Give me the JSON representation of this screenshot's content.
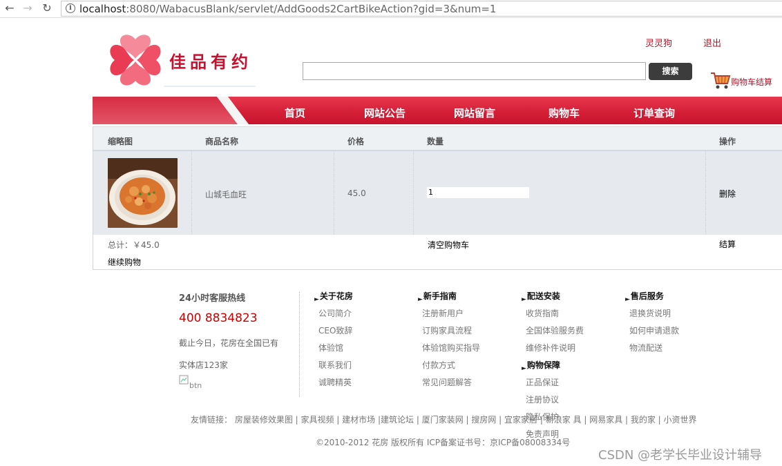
{
  "browser": {
    "url_host": "localhost",
    "url_rest": ":8080/WabacusBlank/servlet/AddGoods2CartBikeAction?gid=3&num=1"
  },
  "header": {
    "logo_text": "佳品有约",
    "user_name": "灵灵狗",
    "logout": "退出",
    "search_placeholder": "",
    "search_button": "搜索",
    "cart_checkout": "购物车结算"
  },
  "nav": {
    "items": [
      {
        "label": "首页"
      },
      {
        "label": "网站公告"
      },
      {
        "label": "网站留言"
      },
      {
        "label": "购物车"
      },
      {
        "label": "订单查询"
      }
    ]
  },
  "cart": {
    "headers": {
      "thumb": "缩略图",
      "name": "商品名称",
      "price": "价格",
      "quantity": "数量",
      "action": "操作"
    },
    "items": [
      {
        "name": "山城毛血旺",
        "price": "45.0",
        "quantity": "1",
        "action": "删除"
      }
    ],
    "total": "总计：￥45.0",
    "clear": "清空购物车",
    "checkout": "结算",
    "continue": "继续购物"
  },
  "footer": {
    "hotline_title": "24小时客服热线",
    "phone": "400 8834823",
    "line1": "截止今日，花房在全国已有",
    "line2": "实体店123家",
    "broken_img_alt": "btn",
    "columns": [
      {
        "title": "关于花房",
        "links": [
          "公司简介",
          "CEO致辞",
          "体验馆",
          "联系我们",
          "诚聘精英"
        ]
      },
      {
        "title": "新手指南",
        "links": [
          "注册新用户",
          "订购家具流程",
          "体验馆购买指导",
          "付款方式",
          "常见问题解答"
        ]
      },
      {
        "title": "配送安装",
        "links": [
          "收货指南",
          "全国体验服务费",
          "维修补件说明"
        ]
      },
      {
        "title": "售后服务",
        "links": [
          "退换货说明",
          "如何申请退款",
          "物流配送"
        ]
      }
    ],
    "extra_title": "购物保障",
    "extra_links": [
      "正品保证",
      "注册协议",
      "隐私保护",
      "免责声明"
    ],
    "friend_links": "友情链接： 房屋装修效果图 | 家具视频 | 建材市场 |建筑论坛 | 厦门家装网 | 搜房网 | 宜家家居 | 新浪家 具 | 网易家具 | 我的家 | 小资世界",
    "copyright": "©2010-2012 花房 版权所有 ICP备案证书号：京ICP备08008334号"
  },
  "watermark": "CSDN @老学长毕业设计辅导",
  "colors": {
    "brand_red": "#d8243a",
    "nav_red": "#d01f38",
    "link_red": "#b0152a",
    "phone_red": "#cc0000"
  }
}
